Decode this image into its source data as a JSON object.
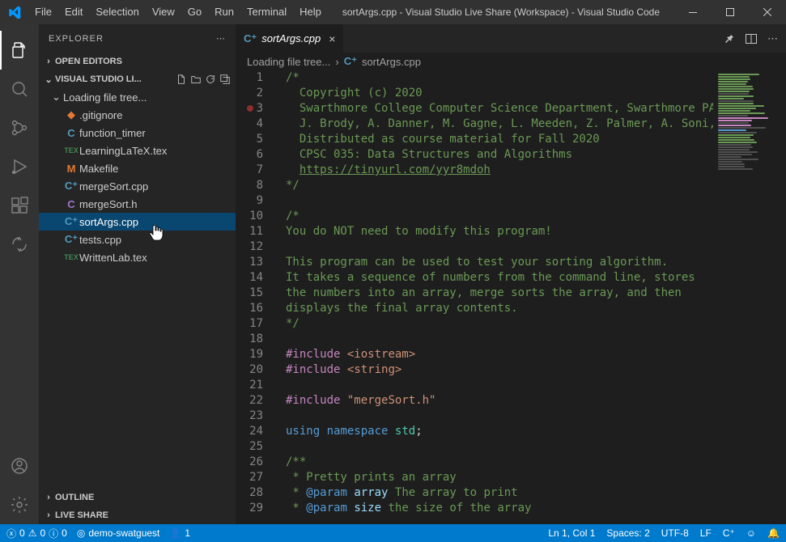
{
  "title": "sortArgs.cpp - Visual Studio Live Share (Workspace) - Visual Studio Code",
  "menu": [
    "File",
    "Edit",
    "Selection",
    "View",
    "Go",
    "Run",
    "Terminal",
    "Help"
  ],
  "sidebar": {
    "header": "EXPLORER",
    "sections": {
      "open_editors": "OPEN EDITORS",
      "workspace": "VISUAL STUDIO LI...",
      "outline": "OUTLINE",
      "live_share": "LIVE SHARE"
    },
    "folder": "Loading file tree...",
    "files": [
      {
        "icon": "git",
        "label": ".gitignore"
      },
      {
        "icon": "c",
        "label": "function_timer"
      },
      {
        "icon": "tex",
        "label": "LearningLaTeX.tex",
        "ico_text": "TEX"
      },
      {
        "icon": "m",
        "label": "Makefile",
        "ico_text": "M"
      },
      {
        "icon": "cpp",
        "label": "mergeSort.cpp",
        "ico_text": "C⁺"
      },
      {
        "icon": "ch",
        "label": "mergeSort.h",
        "ico_text": "C"
      },
      {
        "icon": "cpp",
        "label": "sortArgs.cpp",
        "ico_text": "C⁺",
        "selected": true
      },
      {
        "icon": "cpp",
        "label": "tests.cpp",
        "ico_text": "C⁺"
      },
      {
        "icon": "tex",
        "label": "WrittenLab.tex",
        "ico_text": "TEX"
      }
    ]
  },
  "tabs": [
    {
      "label": "sortArgs.cpp",
      "icon": "C⁺"
    }
  ],
  "breadcrumb": {
    "root": "Loading file tree...",
    "file": "sortArgs.cpp",
    "icon": "C⁺"
  },
  "code": {
    "lines": [
      {
        "n": 1,
        "html": "<span class=\"cmt\">/*</span>"
      },
      {
        "n": 2,
        "html": "<span class=\"cmt\">  Copyright (c) 2020</span>"
      },
      {
        "n": 3,
        "html": "<span class=\"cmt\">  Swarthmore College Computer Science Department, Swarthmore PA</span>",
        "bp": true
      },
      {
        "n": 4,
        "html": "<span class=\"cmt\">  J. Brody, A. Danner, M. Gagne, L. Meeden, Z. Palmer, A. Soni, M.</span>"
      },
      {
        "n": 5,
        "html": "<span class=\"cmt\">  Distributed as course material for Fall 2020</span>"
      },
      {
        "n": 6,
        "html": "<span class=\"cmt\">  CPSC 035: Data Structures and Algorithms</span>"
      },
      {
        "n": 7,
        "html": "<span class=\"cmt\">  </span><span class=\"lnk\">https://tinyurl.com/yyr8mdoh</span>"
      },
      {
        "n": 8,
        "html": "<span class=\"cmt\">*/</span>"
      },
      {
        "n": 9,
        "html": ""
      },
      {
        "n": 10,
        "html": "<span class=\"cmt\">/*</span>"
      },
      {
        "n": 11,
        "html": "<span class=\"cmt\">You do NOT need to modify this program!</span>"
      },
      {
        "n": 12,
        "html": ""
      },
      {
        "n": 13,
        "html": "<span class=\"cmt\">This program can be used to test your sorting algorithm.</span>"
      },
      {
        "n": 14,
        "html": "<span class=\"cmt\">It takes a sequence of numbers from the command line, stores</span>"
      },
      {
        "n": 15,
        "html": "<span class=\"cmt\">the numbers into an array, merge sorts the array, and then</span>"
      },
      {
        "n": 16,
        "html": "<span class=\"cmt\">displays the final array contents.</span>"
      },
      {
        "n": 17,
        "html": "<span class=\"cmt\">*/</span>"
      },
      {
        "n": 18,
        "html": ""
      },
      {
        "n": 19,
        "html": "<span class=\"pp\">#include</span> <span class=\"str\">&lt;iostream&gt;</span>"
      },
      {
        "n": 20,
        "html": "<span class=\"pp\">#include</span> <span class=\"str\">&lt;string&gt;</span>"
      },
      {
        "n": 21,
        "html": ""
      },
      {
        "n": 22,
        "html": "<span class=\"pp\">#include</span> <span class=\"str\">\"mergeSort.h\"</span>"
      },
      {
        "n": 23,
        "html": ""
      },
      {
        "n": 24,
        "html": "<span class=\"kw\">using</span> <span class=\"kw\">namespace</span> <span class=\"ns\">std</span>;"
      },
      {
        "n": 25,
        "html": ""
      },
      {
        "n": 26,
        "html": "<span class=\"doc\">/**</span>"
      },
      {
        "n": 27,
        "html": "<span class=\"doc\"> * Pretty prints an array</span>"
      },
      {
        "n": 28,
        "html": "<span class=\"doc\"> * </span><span class=\"doctag\">@param</span> <span class=\"docvar\">array</span><span class=\"doc\"> The array to print</span>"
      },
      {
        "n": 29,
        "html": "<span class=\"doc\"> * </span><span class=\"doctag\">@param</span> <span class=\"docvar\">size</span><span class=\"doc\"> the size of the array</span>"
      }
    ]
  },
  "status": {
    "errors": "0",
    "warnings": "0",
    "info": "0",
    "live": "demo-swatguest",
    "participants": "1",
    "position": "Ln 1, Col 1",
    "spaces": "Spaces: 2",
    "encoding": "UTF-8",
    "eol": "LF",
    "lang": "C⁺"
  }
}
